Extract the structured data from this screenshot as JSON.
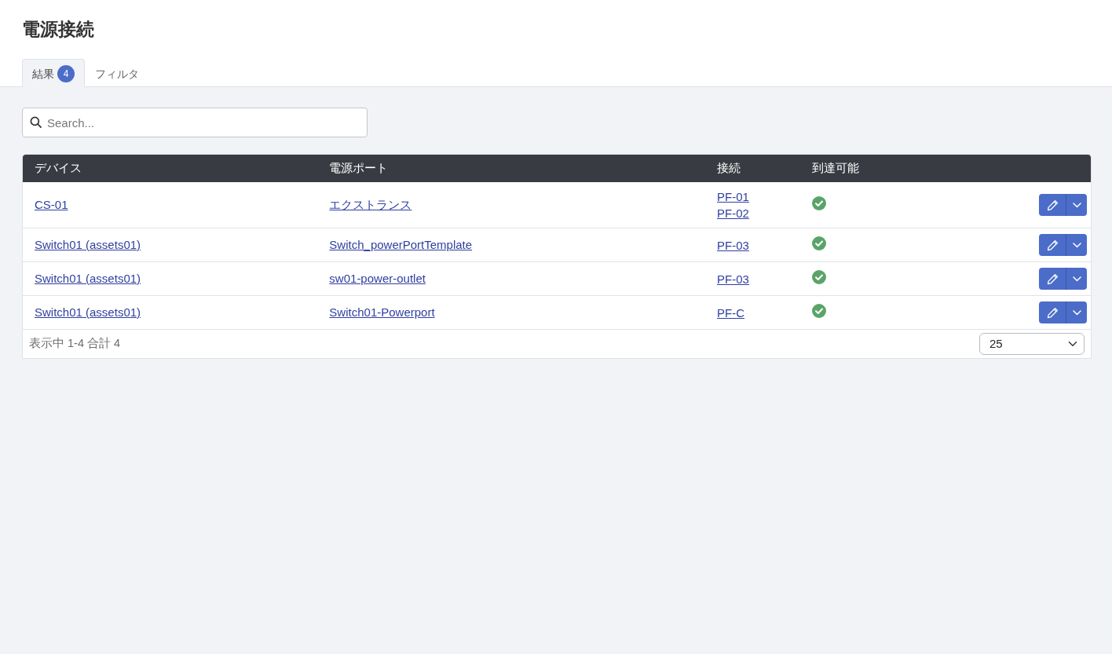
{
  "page_title": "電源接続",
  "tabs": [
    {
      "label": "結果",
      "badge": "4",
      "selected": true
    },
    {
      "label": "フィルタ",
      "selected": false
    }
  ],
  "search": {
    "placeholder": "Search..."
  },
  "table": {
    "columns": [
      "デバイス",
      "電源ポート",
      "接続",
      "到達可能"
    ],
    "rows": [
      {
        "device": "CS-01",
        "power_port": "エクストランス",
        "connections": [
          "PF-01",
          "PF-02"
        ],
        "reachable": true
      },
      {
        "device": "Switch01 (assets01)",
        "power_port": "Switch_powerPortTemplate",
        "connections": [
          "PF-03"
        ],
        "reachable": true
      },
      {
        "device": "Switch01 (assets01)",
        "power_port": "sw01-power-outlet",
        "connections": [
          "PF-03"
        ],
        "reachable": true
      },
      {
        "device": "Switch01 (assets01)",
        "power_port": "Switch01-Powerport",
        "connections": [
          "PF-C"
        ],
        "reachable": true
      }
    ]
  },
  "footer": {
    "summary": "表示中 1-4 合計 4",
    "per_page": "25"
  }
}
